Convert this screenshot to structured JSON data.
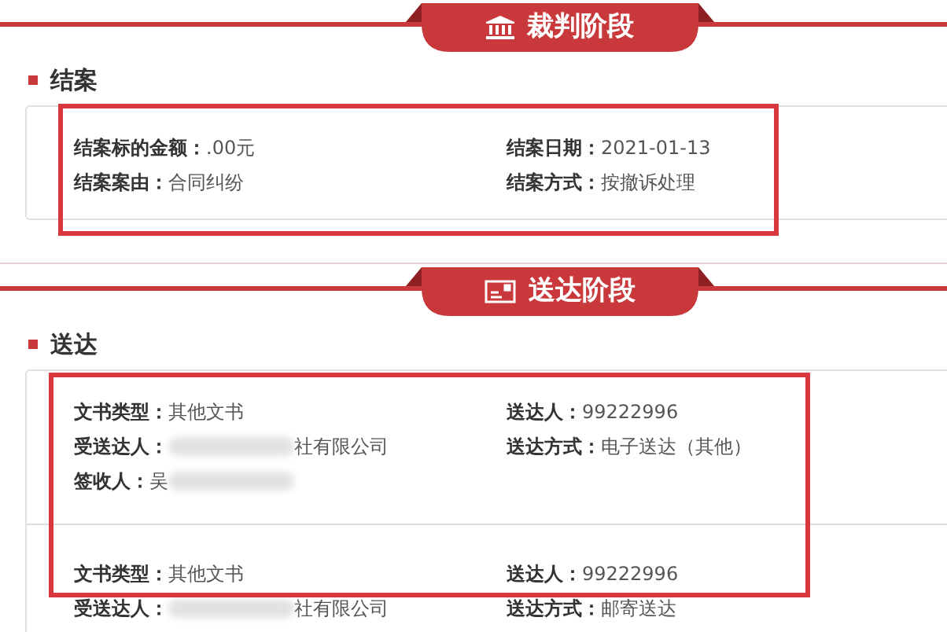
{
  "stages": [
    {
      "title": "裁判阶段",
      "kind": "court",
      "section": "结案",
      "highlighted": true,
      "records": [
        {
          "fields": [
            {
              "label": "结案标的金额：",
              "value": ".00元"
            },
            {
              "label": "结案日期：",
              "value": "2021-01-13"
            },
            {
              "label": "结案案由：",
              "value": "合同纠纷"
            },
            {
              "label": "结案方式：",
              "value": "按撤诉处理"
            }
          ]
        }
      ]
    },
    {
      "title": "送达阶段",
      "kind": "mail",
      "section": "送达",
      "highlighted": true,
      "records": [
        {
          "fields": [
            {
              "label": "文书类型：",
              "value": "其他文书"
            },
            {
              "label": "送达人：",
              "value": "99222996"
            },
            {
              "label": "受送达人：",
              "value": "社有限公司",
              "kind": "maskhead"
            },
            {
              "label": "送达方式：",
              "value": "电子送达（其他）"
            },
            {
              "label": "签收人：",
              "value": "吴",
              "kind": "masktail"
            }
          ]
        },
        {
          "fields": [
            {
              "label": "文书类型：",
              "value": "其他文书"
            },
            {
              "label": "送达人：",
              "value": "99222996"
            },
            {
              "label": "受送达人：",
              "value": "社有限公司",
              "kind": "maskhead"
            },
            {
              "label": "送达方式：",
              "value": "邮寄送达"
            }
          ]
        }
      ]
    }
  ]
}
